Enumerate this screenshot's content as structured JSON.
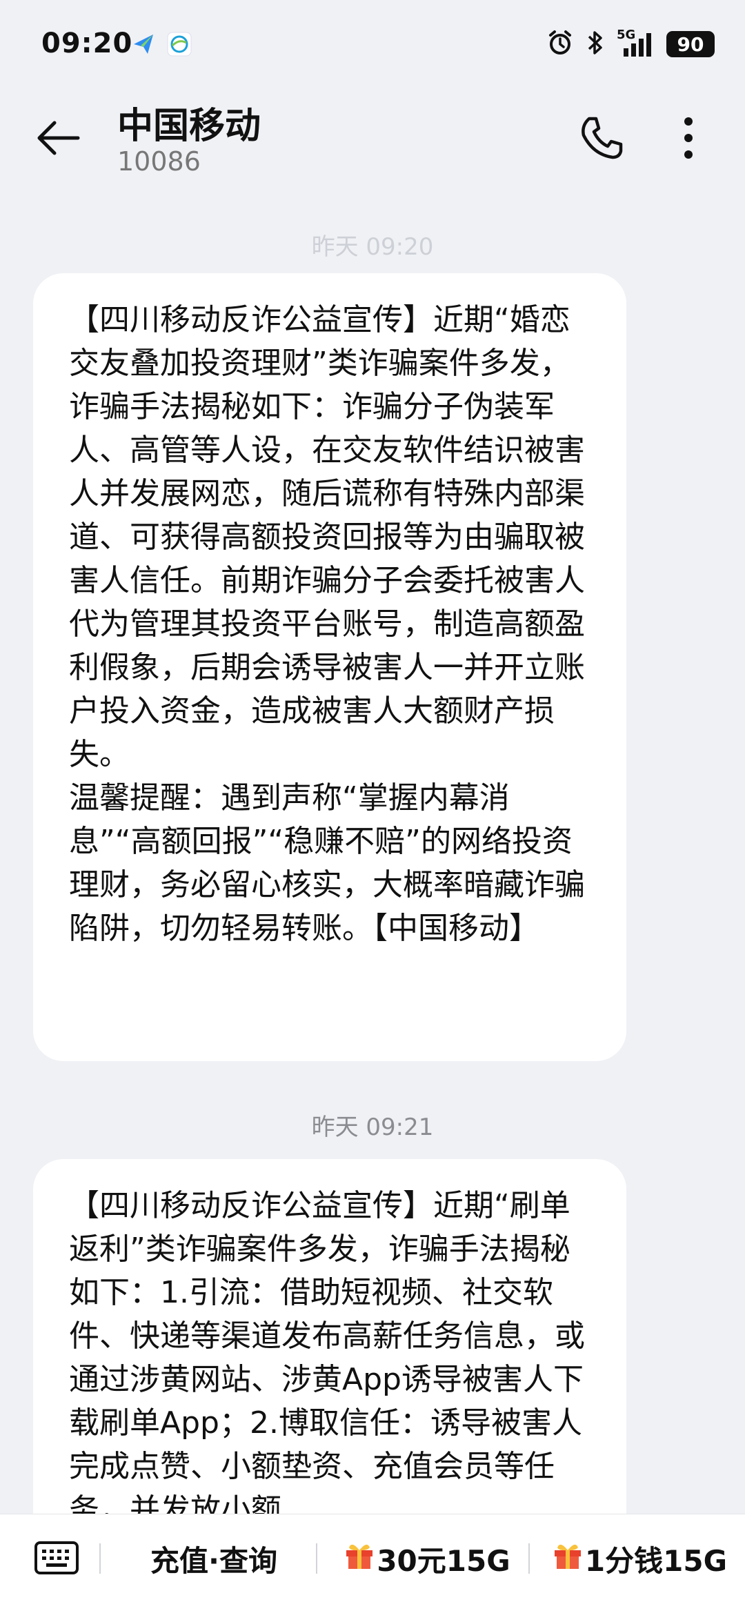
{
  "status_bar": {
    "time": "09:20",
    "network": "5G",
    "battery": "90"
  },
  "header": {
    "contact_name": "中国移动",
    "contact_number": "10086"
  },
  "conversation": {
    "faded_timestamp": "昨天 09:20",
    "messages": [
      {
        "text": "【四川移动反诈公益宣传】近期“婚恋交友叠加投资理财”类诈骗案件多发，诈骗手法揭秘如下：诈骗分子伪装军人、高管等人设，在交友软件结识被害人并发展网恋，随后谎称有特殊内部渠道、可获得高额投资回报等为由骗取被害人信任。前期诈骗分子会委托被害人代为管理其投资平台账号，制造高额盈利假象，后期会诱导被害人一并开立账户投入资金，造成被害人大额财产损失。\n温馨提醒：遇到声称“掌握内幕消息”“高额回报”“稳赚不赔”的网络投资理财，务必留心核实，大概率暗藏诈骗陷阱，切勿轻易转账。【中国移动】"
      },
      {
        "timestamp": "昨天 09:21",
        "text": "【四川移动反诈公益宣传】近期“刷单返利”类诈骗案件多发，诈骗手法揭秘如下：1.引流：借助短视频、社交软件、快递等渠道发布高薪任务信息，或通过涉黄网站、涉黄App诱导被害人下载刷单App；2.博取信任：诱导被害人完成点赞、小额垫资、充值会员等任务，并发放小额"
      }
    ]
  },
  "bottom_menu": {
    "items": [
      {
        "label": "充值·查询"
      },
      {
        "label": "30元15G",
        "icon": "gift-icon"
      },
      {
        "label": "1分钱15G",
        "icon": "gift-icon"
      }
    ]
  },
  "colors": {
    "background": "#f0f1f5",
    "bubble": "#ffffff",
    "gift_red": "#e8412c"
  }
}
